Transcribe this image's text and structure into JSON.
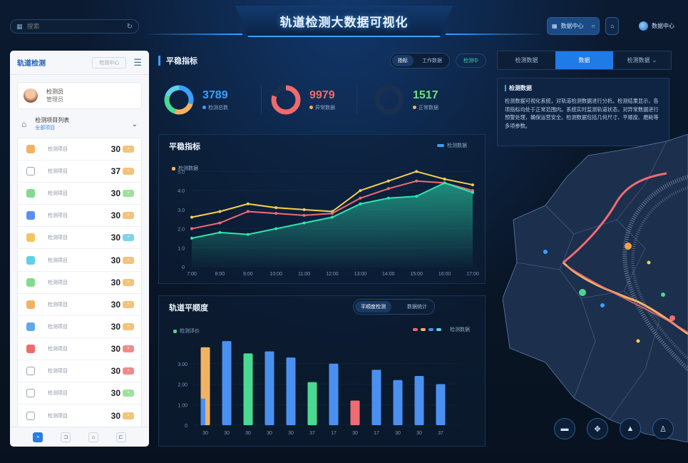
{
  "header": {
    "title": "轨道检测大数据可视化",
    "search_placeholder": "搜索",
    "buttons": [
      {
        "label": "数据中心",
        "icon": "grid-icon",
        "active": true
      },
      {
        "label": "",
        "icon": "circle-icon",
        "active": false
      },
      {
        "label": "",
        "icon": "home-icon",
        "active": false
      }
    ],
    "user_label": "数据中心"
  },
  "left_panel": {
    "logo": "轨道检测",
    "head_button": "检测中心",
    "profile": {
      "name": "检测员",
      "sub": "管理员"
    },
    "section": {
      "title": "检测项目列表",
      "sub": "全部项目"
    },
    "items": [
      {
        "label": "检测项目",
        "value": "30",
        "color": "#f2b264",
        "pill": "#f5c27a"
      },
      {
        "label": "检测项目",
        "value": "37",
        "color": "#ffffff",
        "pill": "#f5c27a"
      },
      {
        "label": "检测项目",
        "value": "30",
        "color": "#7fdc8e",
        "pill": "#9ee29a"
      },
      {
        "label": "检测项目",
        "value": "30",
        "color": "#5b8ff0",
        "pill": "#f5c27a"
      },
      {
        "label": "检测项目",
        "value": "30",
        "color": "#f7c45c",
        "pill": "#7ed3ea"
      },
      {
        "label": "检测项目",
        "value": "30",
        "color": "#5fd0e8",
        "pill": "#f5c27a"
      },
      {
        "label": "检测项目",
        "value": "30",
        "color": "#7fdc8e",
        "pill": "#f5c27a"
      },
      {
        "label": "检测项目",
        "value": "30",
        "color": "#f2b264",
        "pill": "#f5c27a"
      },
      {
        "label": "检测项目",
        "value": "30",
        "color": "#5fa8f0",
        "pill": "#f5c27a"
      },
      {
        "label": "检测项目",
        "value": "30",
        "color": "#ef6b6b",
        "pill": "#f08a8a"
      },
      {
        "label": "检测项目",
        "value": "30",
        "color": "#ffffff",
        "pill": "#f08a8a"
      },
      {
        "label": "检测项目",
        "value": "30",
        "color": "#ffffff",
        "pill": "#9ee29a"
      },
      {
        "label": "检测项目",
        "value": "30",
        "color": "#ffffff",
        "pill": "#f5c27a"
      }
    ],
    "footer": [
      "•",
      "⊐",
      "⌂",
      "⊏"
    ]
  },
  "summary": {
    "title": "平稳指标",
    "tabs": [
      {
        "label": "指标",
        "on": true
      },
      {
        "label": "工作数据",
        "on": false
      }
    ],
    "extra": "检测中",
    "stats": [
      {
        "value": "3789",
        "label": "检测总数",
        "dot": "#3aa0ff",
        "color": "#3aa0ff"
      },
      {
        "value": "9979",
        "label": "异常数据",
        "dot": "#f2b264",
        "color": "#ef6b6b"
      },
      {
        "value": "1517",
        "label": "正常数据",
        "dot": "#f2b264",
        "color": "#6fe07a"
      }
    ],
    "donuts": [
      {
        "segments": [
          {
            "v": 0.3,
            "c": "#3aa0ff"
          },
          {
            "v": 0.25,
            "c": "#f2b264"
          },
          {
            "v": 0.25,
            "c": "#4ad991"
          },
          {
            "v": 0.2,
            "c": "#5fd0e8"
          }
        ]
      },
      {
        "segments": [
          {
            "v": 0.8,
            "c": "#ef6b6b"
          },
          {
            "v": 0.2,
            "c": "#1a3050"
          }
        ]
      },
      {
        "segments": [
          {
            "v": 1.0,
            "c": "#1a3050"
          }
        ]
      }
    ]
  },
  "line_panel": {
    "title": "平稳指标",
    "sub": "检测数据",
    "legend": "检测数据"
  },
  "bar_panel": {
    "title": "轨道平顺度",
    "tabs": [
      "平顺度检测",
      "数据统计"
    ],
    "sub": "检测评价",
    "legend": "检测数据"
  },
  "right": {
    "tabs": [
      {
        "label": "检测数据",
        "on": false
      },
      {
        "label": "数据",
        "on": true
      },
      {
        "label": "检测数据",
        "on": false,
        "chev": true
      }
    ],
    "info_title": "检测数据",
    "info_body": "检测数据可视化系统，对轨道检测数据进行分析。检测结果显示，各项指标均处于正常范围内。系统实时监测轨道状态，对异常数据进行预警处理，确保运营安全。检测数据包括几何尺寸、平顺度、磨耗等多项参数。",
    "map_buttons": [
      "▬",
      "✥",
      "▲",
      "♙"
    ]
  },
  "chart_data": [
    {
      "type": "line",
      "title": "平稳指标",
      "x": [
        "7:00",
        "8:00",
        "9:00",
        "10:00",
        "11:00",
        "12:00",
        "13:00",
        "14:00",
        "15:00",
        "16:00",
        "17:00"
      ],
      "y_ticks": [
        "0",
        "1.0",
        "2.0",
        "3.0",
        "4.0",
        "5.0"
      ],
      "ylim": [
        0,
        5.5
      ],
      "series": [
        {
          "values": [
            2.6,
            2.9,
            3.3,
            3.1,
            3.0,
            2.9,
            4.0,
            4.5,
            5.0,
            4.6,
            4.3
          ],
          "color": "#f7d04f"
        },
        {
          "values": [
            2.0,
            2.3,
            2.9,
            2.8,
            2.7,
            2.8,
            3.6,
            4.1,
            4.5,
            4.4,
            4.0
          ],
          "color": "#f06b74"
        },
        {
          "values": [
            1.5,
            1.8,
            1.7,
            2.0,
            2.3,
            2.6,
            3.3,
            3.6,
            3.7,
            4.4,
            3.9
          ],
          "color": "#2ee6b0",
          "area": true
        }
      ]
    },
    {
      "type": "bar",
      "title": "轨道平顺度",
      "categories": [
        "30",
        "30",
        "30",
        "30",
        "30",
        "37",
        "17",
        "30",
        "17",
        "30",
        "30",
        "37"
      ],
      "y_ticks": [
        "0",
        "1.00",
        "2.00",
        "3.00"
      ],
      "ylim": [
        0,
        4.0
      ],
      "values": [
        3.8,
        4.1,
        3.5,
        3.6,
        3.3,
        2.1,
        3.0,
        1.2,
        2.7,
        2.2,
        2.4,
        2.0
      ],
      "colors": [
        "#f2b264",
        "#4a90f0",
        "#4ad991",
        "#4a90f0",
        "#4a90f0",
        "#4ad991",
        "#4a90f0",
        "#f06b74",
        "#4a90f0",
        "#4a90f0",
        "#4a90f0",
        "#4a90f0"
      ],
      "overlay": [
        {
          "index": 0,
          "value": 1.3,
          "color": "#4a90f0"
        }
      ]
    }
  ]
}
